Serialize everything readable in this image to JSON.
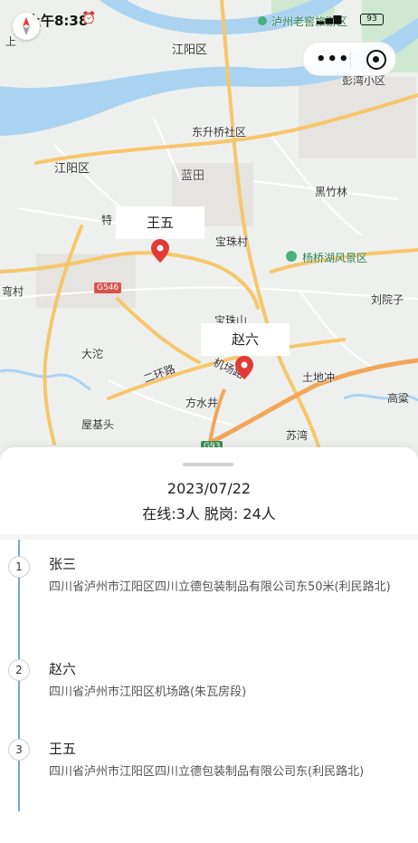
{
  "status_bar": {
    "time": "上午8:38",
    "signal": "📶",
    "battery": "93"
  },
  "map": {
    "labels": {
      "jiangyang_district_top": "江阳区",
      "jiangyang_district_left": "江阳区",
      "dongsheng": "东升桥社区",
      "lantian": "蓝田",
      "heizhulin": "黑竹林",
      "baozhucun": "宝珠村",
      "yangqiaohu": "杨桥湖风景区",
      "pengwan": "彭湾小区",
      "luzhou_top": "泸州老窖旅游区",
      "liuyuanzi": "刘院子",
      "baozhushan": "宝珠山",
      "dazhu": "大沱",
      "erhuanlu": "二环路",
      "jichanglu": "机场路",
      "fangshuijing": "方水井",
      "tudichong": "土地冲",
      "wujitou": "屋基头",
      "suwan": "苏湾",
      "gaoliang": "高粱",
      "wancun": "弯村",
      "te": "特",
      "shang": "上",
      "road_g546": "G546",
      "road_g93": "G93"
    },
    "markers": [
      {
        "name": "王五"
      },
      {
        "name": "赵六"
      }
    ]
  },
  "sheet": {
    "date": "2023/07/22",
    "summary": "在线:3人 脱岗: 24人",
    "items": [
      {
        "index": "1",
        "name": "张三",
        "address": "四川省泸州市江阳区四川立德包装制品有限公司东50米(利民路北)"
      },
      {
        "index": "2",
        "name": "赵六",
        "address": "四川省泸州市江阳区机场路(朱瓦房段)"
      },
      {
        "index": "3",
        "name": "王五",
        "address": "四川省泸州市江阳区四川立德包装制品有限公司东(利民路北)"
      }
    ]
  },
  "colors": {
    "water": "#aad3f2",
    "park": "#cfe8d2",
    "major_road": "#f6c66a",
    "highway": "#f2a65a",
    "marker": "#e53935",
    "timeline": "#7aa6c8"
  }
}
